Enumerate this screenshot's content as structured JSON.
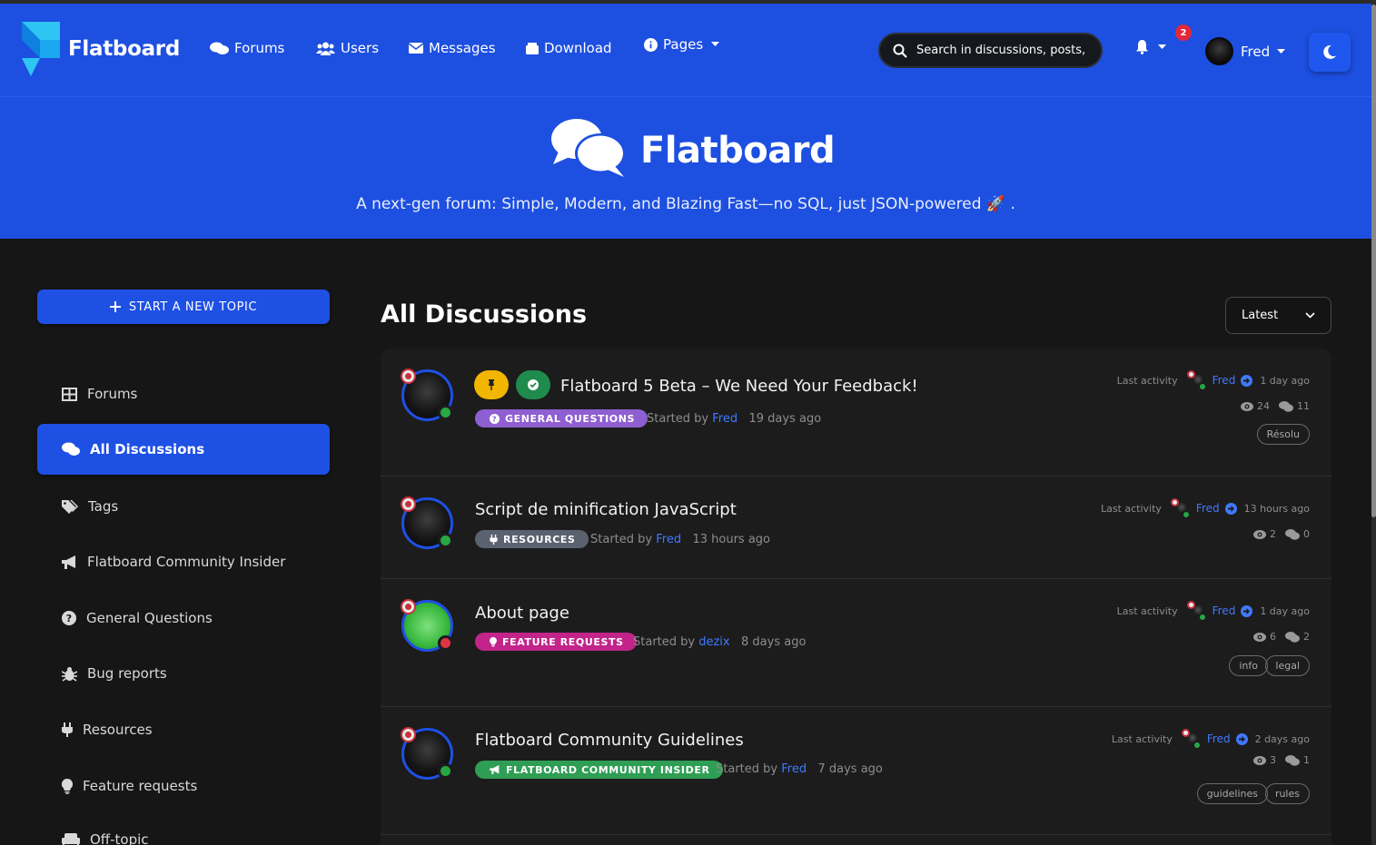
{
  "brand": {
    "name": "Flatboard"
  },
  "nav": {
    "forums": "Forums",
    "users": "Users",
    "messages": "Messages",
    "download": "Download",
    "pages": "Pages"
  },
  "search": {
    "placeholder": "Search in discussions, posts, and more"
  },
  "notifications": {
    "count": "2"
  },
  "user": {
    "name": "Fred"
  },
  "hero": {
    "title": "Flatboard",
    "subtitle": "A next-gen forum: Simple, Modern, and Blazing Fast—no SQL, just JSON-powered 🚀 ."
  },
  "sidebar": {
    "new_topic": "START A NEW TOPIC",
    "items": [
      {
        "label": "Forums",
        "icon": "grid-icon"
      },
      {
        "label": "All Discussions",
        "icon": "comments-icon"
      },
      {
        "label": "Tags",
        "icon": "tags-icon"
      },
      {
        "label": "Flatboard Community Insider",
        "icon": "bullhorn-icon"
      },
      {
        "label": "General Questions",
        "icon": "question-circle-icon"
      },
      {
        "label": "Bug reports",
        "icon": "bug-icon"
      },
      {
        "label": "Resources",
        "icon": "plug-icon"
      },
      {
        "label": "Feature requests",
        "icon": "lightbulb-icon"
      },
      {
        "label": "Off-topic",
        "icon": "couch-icon"
      }
    ]
  },
  "main": {
    "title": "All Discussions",
    "sort": "Latest"
  },
  "labels": {
    "last_activity": "Last activity",
    "started_by": "Started by"
  },
  "discussions": [
    {
      "title": "Flatboard 5 Beta – We Need Your Feedback!",
      "category": "GENERAL QUESTIONS",
      "category_color": "#8e5fd0",
      "author": "Fred",
      "started_ago": "19 days ago",
      "last_user": "Fred",
      "last_ago": "1 day ago",
      "views": "24",
      "replies": "11",
      "tags": [
        "Résolu"
      ]
    },
    {
      "title": "Script de minification JavaScript",
      "category": "RESOURCES",
      "category_color": "#5a6270",
      "author": "Fred",
      "started_ago": "13 hours ago",
      "last_user": "Fred",
      "last_ago": "13 hours ago",
      "views": "2",
      "replies": "0",
      "tags": []
    },
    {
      "title": "About page",
      "category": "FEATURE REQUESTS",
      "category_color": "#c2248a",
      "author": "dezix",
      "started_ago": "8 days ago",
      "last_user": "Fred",
      "last_ago": "1 day ago",
      "views": "6",
      "replies": "2",
      "tags": [
        "info",
        "legal"
      ]
    },
    {
      "title": "Flatboard Community Guidelines",
      "category": "FLATBOARD COMMUNITY INSIDER",
      "category_color": "#2f9e55",
      "author": "Fred",
      "started_ago": "7 days ago",
      "last_user": "Fred",
      "last_ago": "2 days ago",
      "views": "3",
      "replies": "1",
      "tags": [
        "guidelines",
        "rules"
      ]
    }
  ]
}
